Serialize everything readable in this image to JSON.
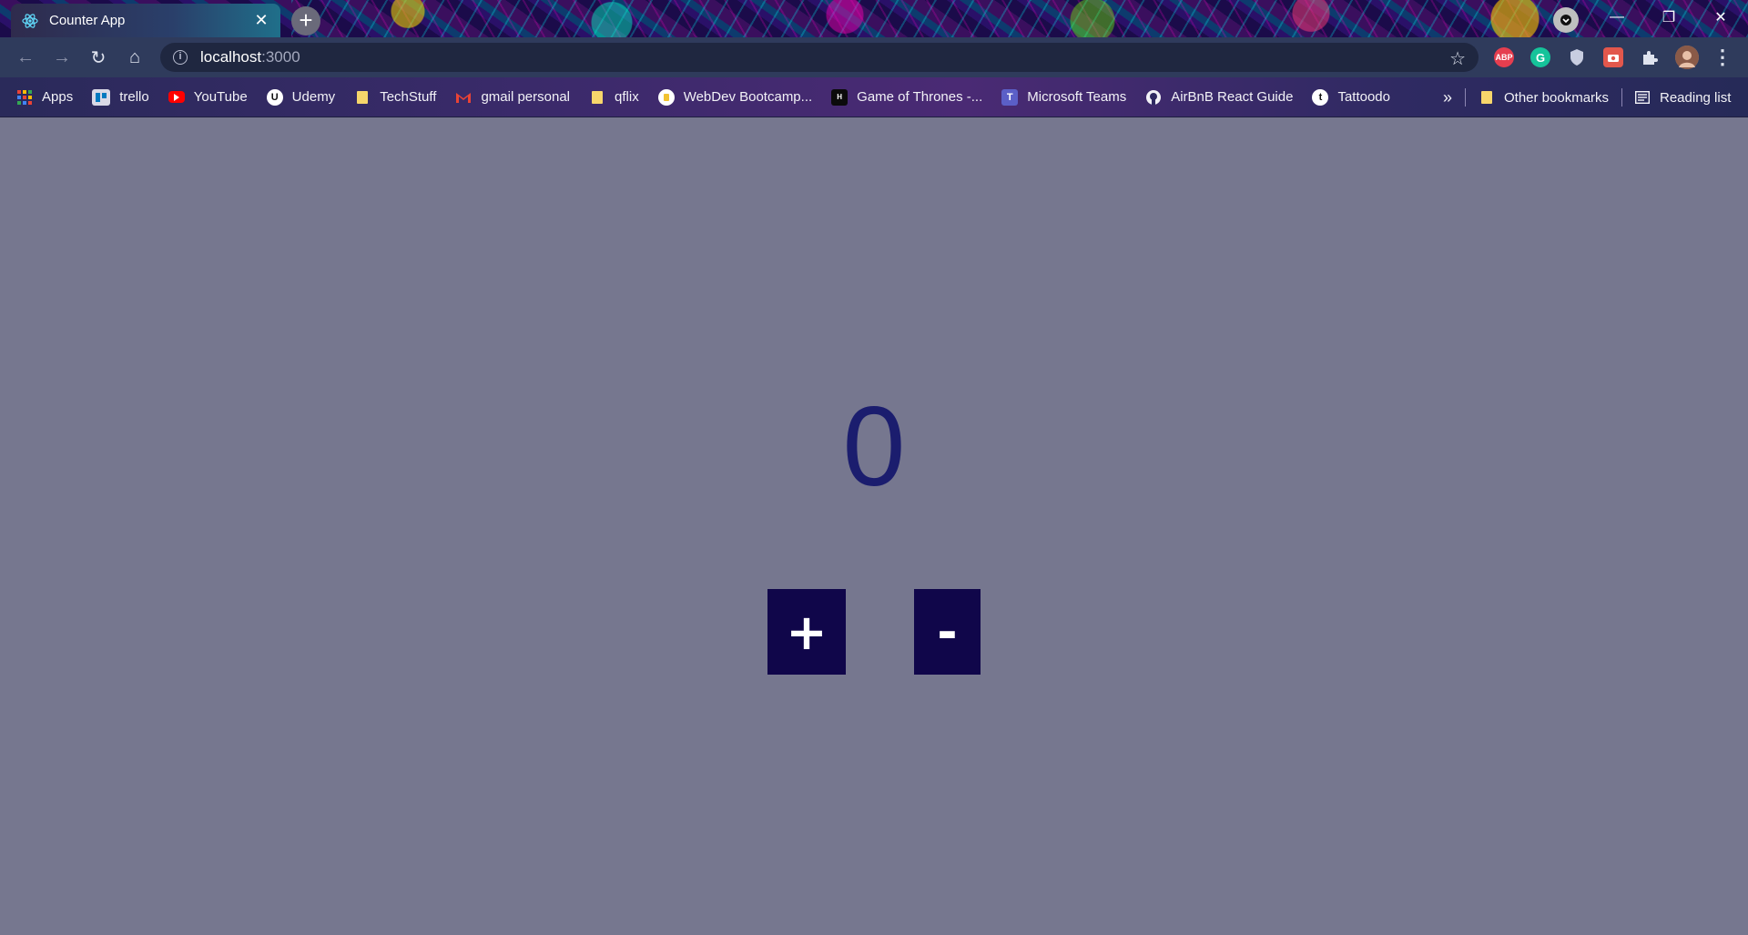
{
  "browser": {
    "tab": {
      "title": "Counter App",
      "favicon": "react-icon",
      "close": "✕"
    },
    "new_tab": "+",
    "window_controls": {
      "minimize": "—",
      "restore": "❐",
      "close": "✕"
    },
    "toolbar": {
      "back": "←",
      "forward": "→",
      "reload": "↻",
      "home": "⌂",
      "url_host": "localhost",
      "url_port": ":3000",
      "bookmark_star": "☆",
      "extensions": [
        {
          "name": "adblock-plus-icon",
          "label": "ABP",
          "color": "#e53e4f"
        },
        {
          "name": "grammarly-icon",
          "label": "G",
          "color": "#15c39a"
        },
        {
          "name": "shield-extension-icon",
          "label": "",
          "color": "#c8cde0"
        },
        {
          "name": "camera-extension-icon",
          "label": "",
          "color": "#e2574c"
        },
        {
          "name": "puzzle-extensions-icon",
          "label": "",
          "color": "#dfe3ee"
        }
      ],
      "menu": "⋮"
    },
    "bookmarks": [
      {
        "label": "Apps",
        "icon": "apps-grid-icon"
      },
      {
        "label": "trello",
        "icon": "trello-icon"
      },
      {
        "label": "YouTube",
        "icon": "youtube-icon"
      },
      {
        "label": "Udemy",
        "icon": "udemy-icon"
      },
      {
        "label": "TechStuff",
        "icon": "folder-icon"
      },
      {
        "label": "gmail personal",
        "icon": "gmail-icon"
      },
      {
        "label": "qflix",
        "icon": "folder-icon"
      },
      {
        "label": "WebDev Bootcamp...",
        "icon": "bootcamp-icon"
      },
      {
        "label": "Game of Thrones -...",
        "icon": "hbo-icon"
      },
      {
        "label": "Microsoft Teams",
        "icon": "teams-icon"
      },
      {
        "label": "AirBnB React Guide",
        "icon": "github-icon"
      },
      {
        "label": "Tattoodo",
        "icon": "tattoodo-icon"
      }
    ],
    "bookmarks_overflow": "»",
    "other_bookmarks": "Other bookmarks",
    "reading_list": "Reading list"
  },
  "app": {
    "count": "0",
    "increment_label": "+",
    "decrement_label": "-",
    "colors": {
      "background": "#76778f",
      "count_text": "#1b1d6e",
      "button_bg": "#10064a"
    }
  }
}
